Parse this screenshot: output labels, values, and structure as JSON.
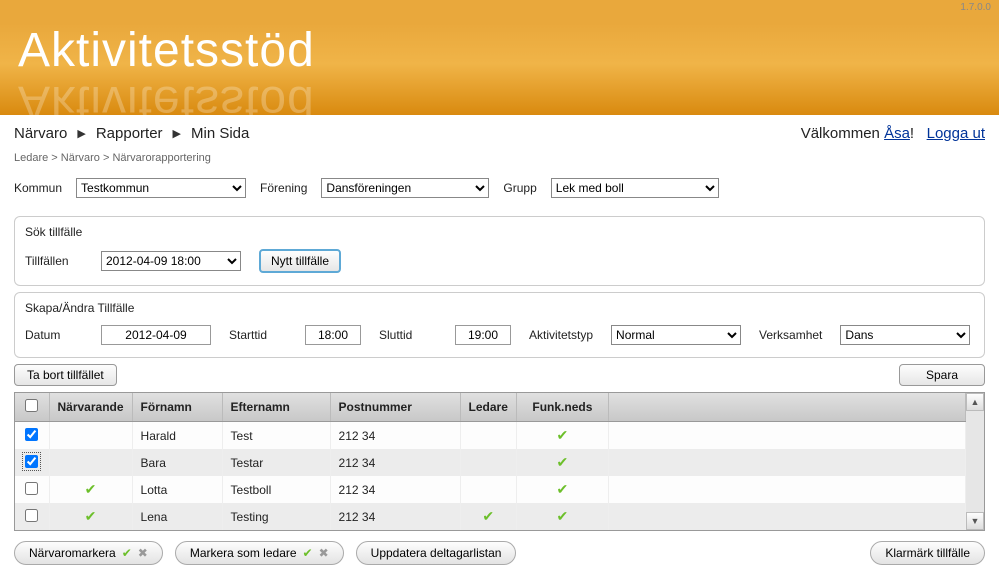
{
  "version": "1.7.0.0",
  "app_title": "Aktivitetsstöd",
  "topnav": {
    "items": [
      "Närvaro",
      "Rapporter",
      "Min Sida"
    ]
  },
  "welcome": {
    "prefix": "Välkommen ",
    "user": "Åsa",
    "suffix": "!",
    "logout": "Logga ut"
  },
  "breadcrumb": "Ledare > Närvaro > Närvarorapportering",
  "filters": {
    "kommun_label": "Kommun",
    "kommun_value": "Testkommun",
    "forening_label": "Förening",
    "forening_value": "Dansföreningen",
    "grupp_label": "Grupp",
    "grupp_value": "Lek med boll"
  },
  "sok": {
    "title": "Sök tillfälle",
    "tillfallen_label": "Tillfällen",
    "tillfallen_value": "2012-04-09 18:00",
    "nytt_btn": "Nytt tillfälle"
  },
  "skapa": {
    "title": "Skapa/Ändra Tillfälle",
    "datum_label": "Datum",
    "datum_value": "2012-04-09",
    "starttid_label": "Starttid",
    "starttid_value": "18:00",
    "sluttid_label": "Sluttid",
    "sluttid_value": "19:00",
    "aktivitetstyp_label": "Aktivitetstyp",
    "aktivitetstyp_value": "Normal",
    "verksamhet_label": "Verksamhet",
    "verksamhet_value": "Dans"
  },
  "actions": {
    "tabort": "Ta bort tillfället",
    "spara": "Spara"
  },
  "table": {
    "headers": {
      "narvarande": "Närvarande",
      "fornamn": "Förnamn",
      "efternamn": "Efternamn",
      "postnummer": "Postnummer",
      "ledare": "Ledare",
      "funkneds": "Funk.neds"
    },
    "rows": [
      {
        "checked": true,
        "focused": false,
        "narvarande": false,
        "fornamn": "Harald",
        "efternamn": "Test",
        "postnummer": "212 34",
        "ledare": false,
        "funkneds": true
      },
      {
        "checked": true,
        "focused": true,
        "narvarande": false,
        "fornamn": "Bara",
        "efternamn": "Testar",
        "postnummer": "212 34",
        "ledare": false,
        "funkneds": true
      },
      {
        "checked": false,
        "focused": false,
        "narvarande": true,
        "fornamn": "Lotta",
        "efternamn": "Testboll",
        "postnummer": "212 34",
        "ledare": false,
        "funkneds": true
      },
      {
        "checked": false,
        "focused": false,
        "narvarande": true,
        "fornamn": "Lena",
        "efternamn": "Testing",
        "postnummer": "212 34",
        "ledare": true,
        "funkneds": true
      }
    ]
  },
  "bottom": {
    "narvaromarkera": "Närvaromarkera",
    "markera_ledare": "Markera som ledare",
    "uppdatera": "Uppdatera deltagarlistan",
    "klarmark": "Klarmärk tillfälle"
  }
}
